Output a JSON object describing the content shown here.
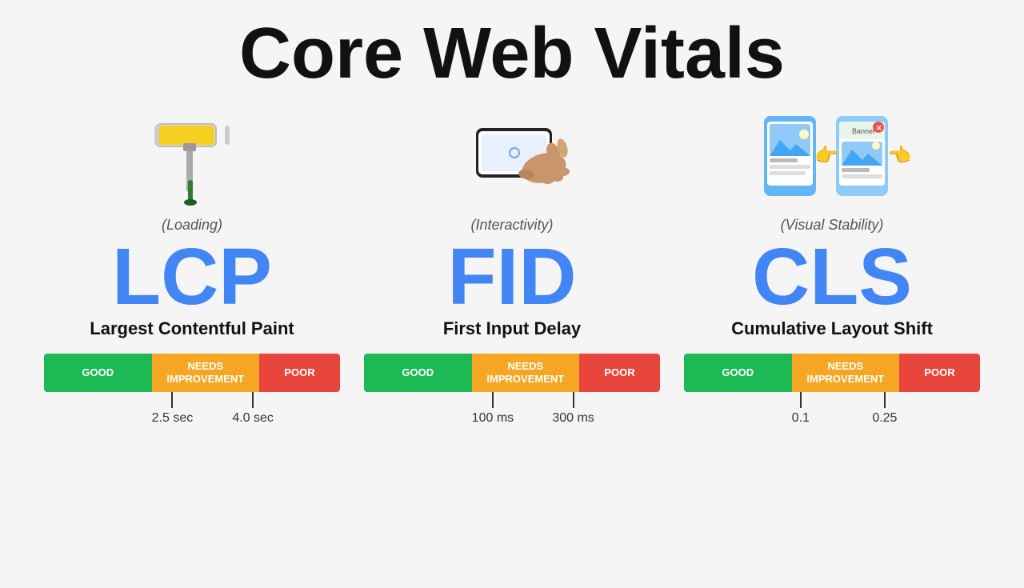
{
  "page": {
    "title": "Core Web Vitals",
    "background": "#f5f5f5"
  },
  "vitals": [
    {
      "id": "lcp",
      "acronym": "LCP",
      "name": "Largest Contentful Paint",
      "category": "(Loading)",
      "icon_type": "paint",
      "scale": {
        "good_label": "GOOD",
        "needs_label": "NEEDS\nIMPROVEMENT",
        "poor_label": "POOR",
        "marker1_value": "2.5 sec",
        "marker2_value": "4.0 sec"
      }
    },
    {
      "id": "fid",
      "acronym": "FID",
      "name": "First Input Delay",
      "category": "(Interactivity)",
      "icon_type": "phone",
      "scale": {
        "good_label": "GOOD",
        "needs_label": "NEEDS\nIMPROVEMENT",
        "poor_label": "POOR",
        "marker1_value": "100 ms",
        "marker2_value": "300 ms"
      }
    },
    {
      "id": "cls",
      "acronym": "CLS",
      "name": "Cumulative Layout Shift",
      "category": "(Visual Stability)",
      "icon_type": "phones",
      "scale": {
        "good_label": "GOOD",
        "needs_label": "NEEDS\nIMPROVEMENT",
        "poor_label": "POOR",
        "marker1_value": "0.1",
        "marker2_value": "0.25"
      }
    }
  ]
}
